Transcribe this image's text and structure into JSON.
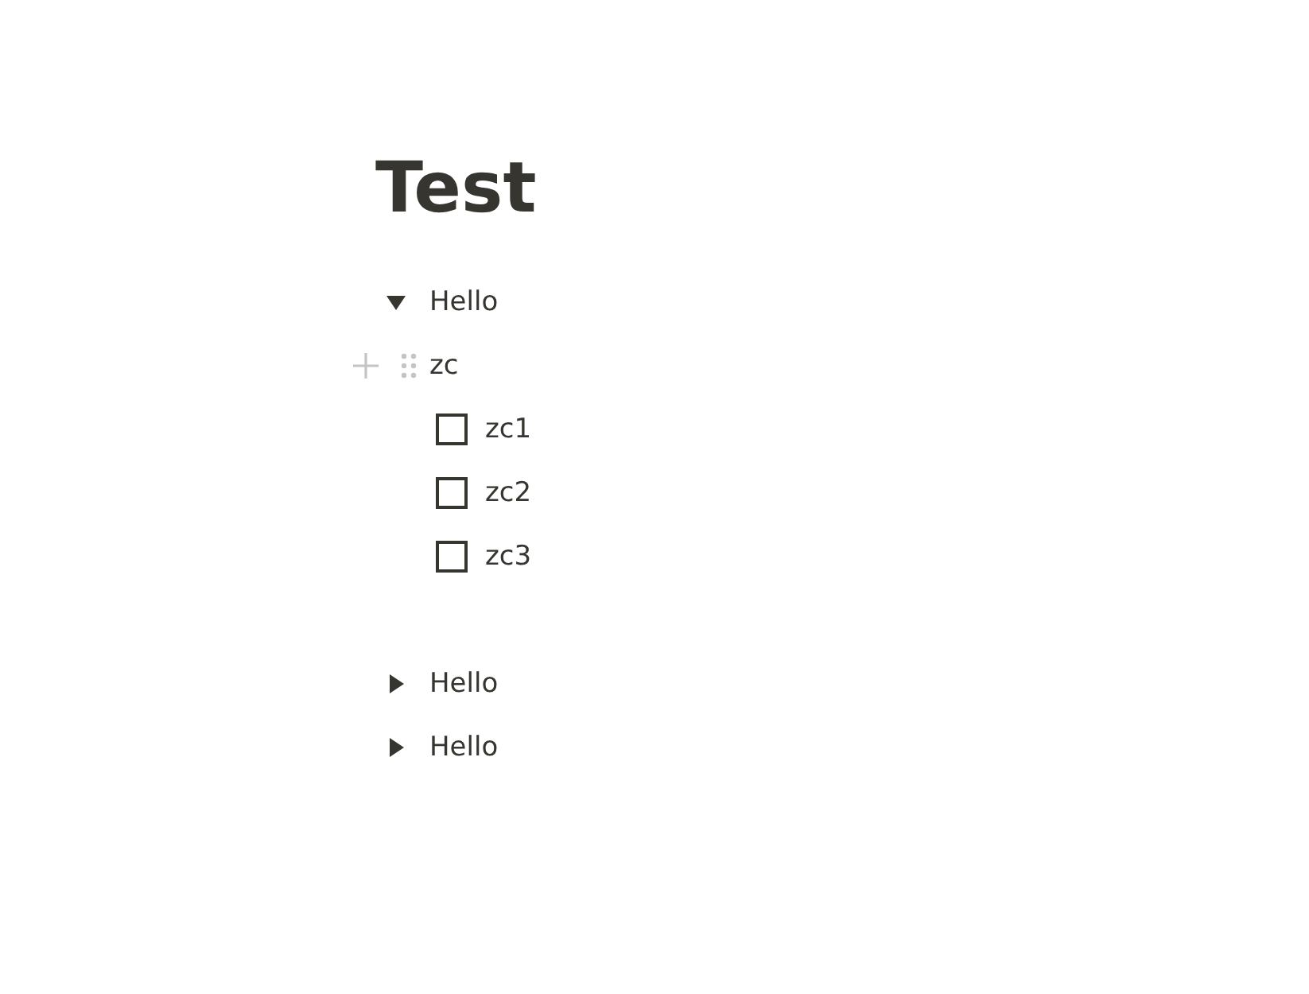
{
  "title": "Test",
  "blocks": [
    {
      "kind": "toggle",
      "text": "Hello",
      "expanded": true,
      "children": [
        {
          "kind": "text",
          "text": "zc",
          "hovered": true,
          "children": [
            {
              "kind": "todo",
              "text": "zc1",
              "checked": false
            },
            {
              "kind": "todo",
              "text": "zc2",
              "checked": false
            },
            {
              "kind": "todo",
              "text": "zc3",
              "checked": false
            }
          ]
        }
      ]
    },
    {
      "kind": "empty"
    },
    {
      "kind": "toggle",
      "text": "Hello",
      "expanded": false
    },
    {
      "kind": "toggle",
      "text": "Hello",
      "expanded": false
    }
  ]
}
